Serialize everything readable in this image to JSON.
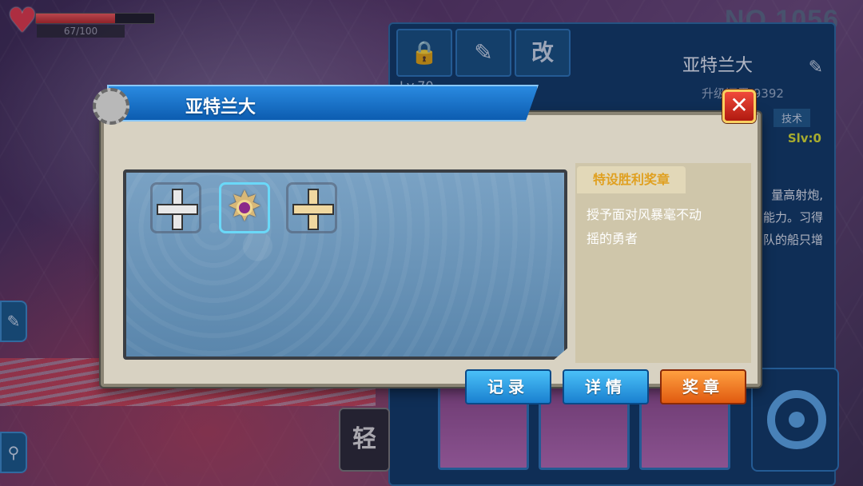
{
  "hud": {
    "hp_text": "67/100",
    "hp_fraction": 0.67,
    "ship_number": "NO.1056"
  },
  "background_panel": {
    "tab_mod_label": "改",
    "ship_name": "亚特兰大",
    "level": "Lv.70",
    "exp_text": "升级还需 9392",
    "tech_label": "技术",
    "slv": "Slv:0",
    "skill_text": [
      "量高射炮,",
      "能力。习得",
      "队的船只增"
    ],
    "ship_class_badge": "轻"
  },
  "dialog": {
    "title": "亚特兰大",
    "close_label": "✕",
    "medals": [
      {
        "name": "silver-cross-medal",
        "color": "#e8e8e8",
        "selected": false
      },
      {
        "name": "star-order-medal",
        "color": "#d8b878",
        "selected": true
      },
      {
        "name": "gold-cross-medal",
        "color": "#f0d8a0",
        "selected": false
      }
    ],
    "info": {
      "medal_title": "特设胜利奖章",
      "medal_desc_line1": "授予面对风暴毫不动",
      "medal_desc_line2": "摇的勇者"
    },
    "buttons": {
      "record": "记录",
      "details": "详情",
      "medal": "奖章"
    }
  }
}
